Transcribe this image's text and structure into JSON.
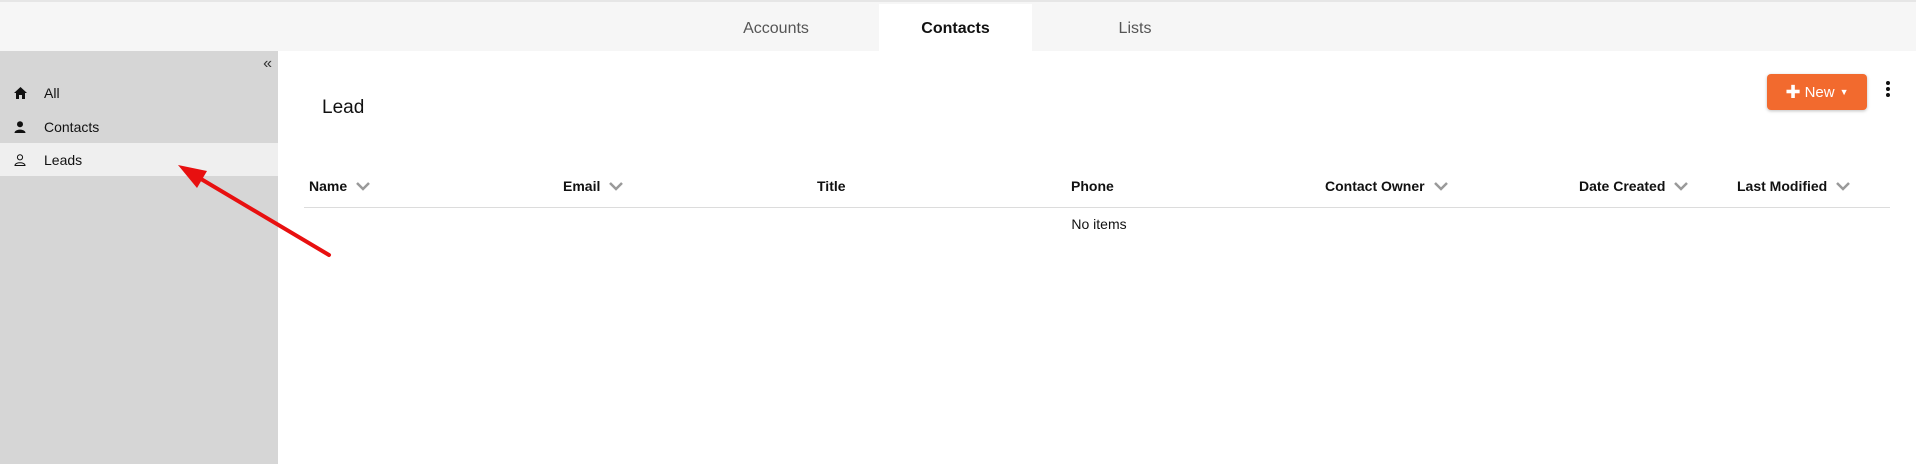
{
  "tabs": [
    {
      "label": "Accounts",
      "active": false
    },
    {
      "label": "Contacts",
      "active": true
    },
    {
      "label": "Lists",
      "active": false
    }
  ],
  "sidebar": {
    "collapse_icon": "double-chevron-left-icon",
    "items": [
      {
        "label": "All",
        "icon": "home-icon",
        "active": false
      },
      {
        "label": "Contacts",
        "icon": "person-icon",
        "active": false
      },
      {
        "label": "Leads",
        "icon": "person-outline-icon",
        "active": true
      }
    ]
  },
  "main": {
    "title": "Lead",
    "new_button": {
      "label": "New",
      "icon": "plus-icon"
    },
    "more_menu_icon": "kebab-icon",
    "columns": [
      {
        "label": "Name",
        "sortable": true
      },
      {
        "label": "Email",
        "sortable": true
      },
      {
        "label": "Title",
        "sortable": false
      },
      {
        "label": "Phone",
        "sortable": false
      },
      {
        "label": "Contact Owner",
        "sortable": true
      },
      {
        "label": "Date Created",
        "sortable": true
      },
      {
        "label": "Last Modified",
        "sortable": true
      }
    ],
    "empty_text": "No items"
  },
  "colors": {
    "accent": "#f26a2e",
    "sidebar_bg": "#d6d6d6",
    "sidebar_active_bg": "#efefef",
    "annotation_arrow": "#e81010"
  }
}
